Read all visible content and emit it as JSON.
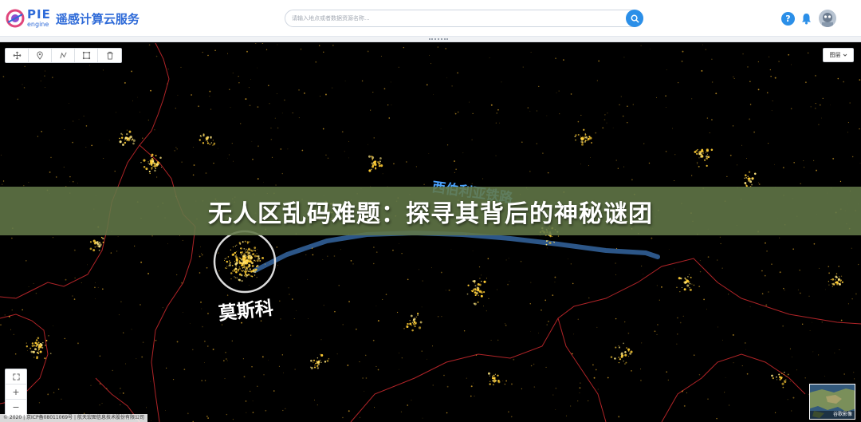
{
  "header": {
    "logo_brand": "PIE",
    "logo_sub": "engine",
    "app_title": "遥感计算云服务",
    "search_placeholder": "请输入地点或者数据资源名称..."
  },
  "map": {
    "layer_button_label": "图层",
    "zoom_in": "+",
    "zoom_out": "−",
    "copyright": "© 2020 | 京ICP备08011069号 | 航天宏图信息技术股份有限公司",
    "minimap_label": "谷歌影像",
    "city_label": "莫斯科",
    "railway_label": "西伯利亚铁路"
  },
  "banner": {
    "title": "无人区乱码难题：探寻其背后的神秘谜团"
  },
  "colors": {
    "brand_blue": "#2f6bd8",
    "search_button": "#2b8fe8",
    "banner_bg": "#627848",
    "city_lights": "#ffcc33",
    "border_lines": "#c4282c"
  },
  "icons": {
    "toolbar": [
      "pan-icon",
      "marker-icon",
      "measure-icon",
      "rectangle-select-icon",
      "trash-icon"
    ],
    "header": [
      "help-icon",
      "bell-icon",
      "avatar"
    ]
  }
}
